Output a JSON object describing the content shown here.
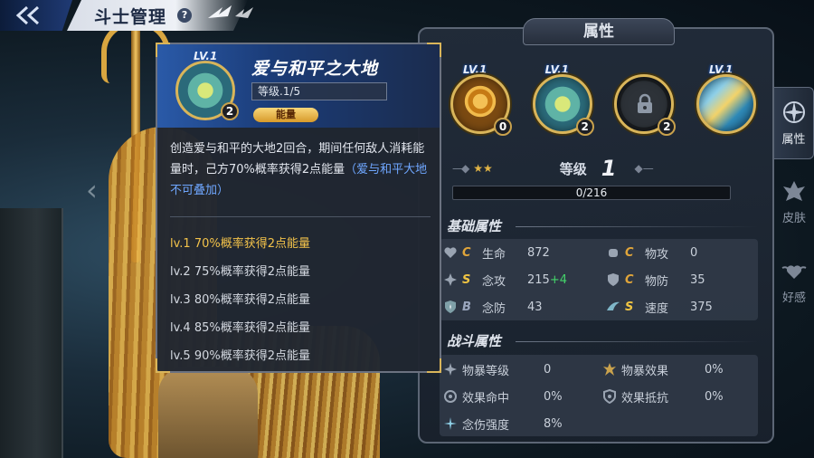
{
  "header": {
    "title": "斗士管理",
    "help_icon": "?"
  },
  "panel": {
    "title": "属性",
    "skills": [
      {
        "lv": "LV.1",
        "count": "0",
        "icon": "golden-ring-skill-icon"
      },
      {
        "lv": "LV.1",
        "count": "2",
        "icon": "earth-peace-skill-icon"
      },
      {
        "lv": "",
        "count": "2",
        "icon": "locked-skill-icon"
      },
      {
        "lv": "LV.1",
        "count": "",
        "icon": "wave-skill-icon"
      }
    ],
    "level_label": "等级",
    "level_value": "1",
    "exp_text": "0/216",
    "exp_fraction": 0,
    "basic_title": "基础属性",
    "basic_stats": [
      {
        "grade": "C",
        "name": "生命",
        "value": "872",
        "bonus": ""
      },
      {
        "grade": "C",
        "name": "物攻",
        "value": "0",
        "bonus": ""
      },
      {
        "grade": "S",
        "name": "念攻",
        "value": "215",
        "bonus": "+4"
      },
      {
        "grade": "C",
        "name": "物防",
        "value": "35",
        "bonus": ""
      },
      {
        "grade": "B",
        "name": "念防",
        "value": "43",
        "bonus": ""
      },
      {
        "grade": "S",
        "name": "速度",
        "value": "375",
        "bonus": ""
      }
    ],
    "battle_title": "战斗属性",
    "battle_stats": [
      {
        "name": "物暴等级",
        "value": "0"
      },
      {
        "name": "物暴效果",
        "value": "0%"
      },
      {
        "name": "效果命中",
        "value": "0%"
      },
      {
        "name": "效果抵抗",
        "value": "0%"
      },
      {
        "name": "念伤强度",
        "value": "8%"
      }
    ]
  },
  "side_tabs": [
    {
      "label": "属性",
      "active": true
    },
    {
      "label": "皮肤",
      "active": false
    },
    {
      "label": "好感",
      "active": false
    }
  ],
  "tooltip": {
    "lv": "LV.1",
    "count": "2",
    "title": "爱与和平之大地",
    "level": "等级.1/5",
    "badge": "能量",
    "desc_main": "创造爱与和平的大地2回合，期间任何敌人消耗能量时，己方70%概率获得2点能量",
    "desc_note": "（爱与和平大地不可叠加）",
    "levels": [
      "lv.1 70%概率获得2点能量",
      "lv.2 75%概率获得2点能量",
      "lv.3 80%概率获得2点能量",
      "lv.4 85%概率获得2点能量",
      "lv.5 90%概率获得2点能量"
    ]
  },
  "colors": {
    "accent_gold": "#d9b55a",
    "exp_blue": "#2c7be0",
    "bonus_green": "#44d46a",
    "highlight_blue": "#6fa7ff",
    "current_level": "#f2c24a"
  }
}
